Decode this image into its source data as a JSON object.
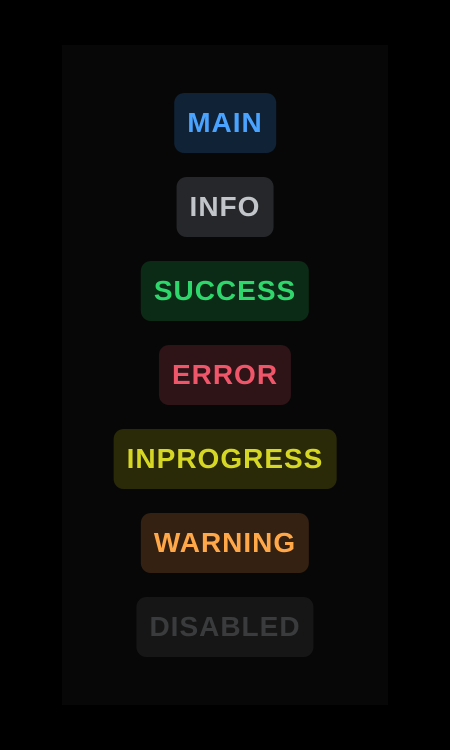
{
  "badges": [
    {
      "label": "MAIN",
      "text_color": "#4aa3ff",
      "bg_color": "#0f2236"
    },
    {
      "label": "INFO",
      "text_color": "#c2c6ca",
      "bg_color": "#25272a"
    },
    {
      "label": "SUCCESS",
      "text_color": "#2fd66b",
      "bg_color": "#0b2b16"
    },
    {
      "label": "ERROR",
      "text_color": "#f0566a",
      "bg_color": "#2e1317"
    },
    {
      "label": "INPROGRESS",
      "text_color": "#d6d624",
      "bg_color": "#2a2a09"
    },
    {
      "label": "WARNING",
      "text_color": "#ffa84a",
      "bg_color": "#352111"
    },
    {
      "label": "DISABLED",
      "text_color": "#3a3b3d",
      "bg_color": "#161616"
    }
  ]
}
